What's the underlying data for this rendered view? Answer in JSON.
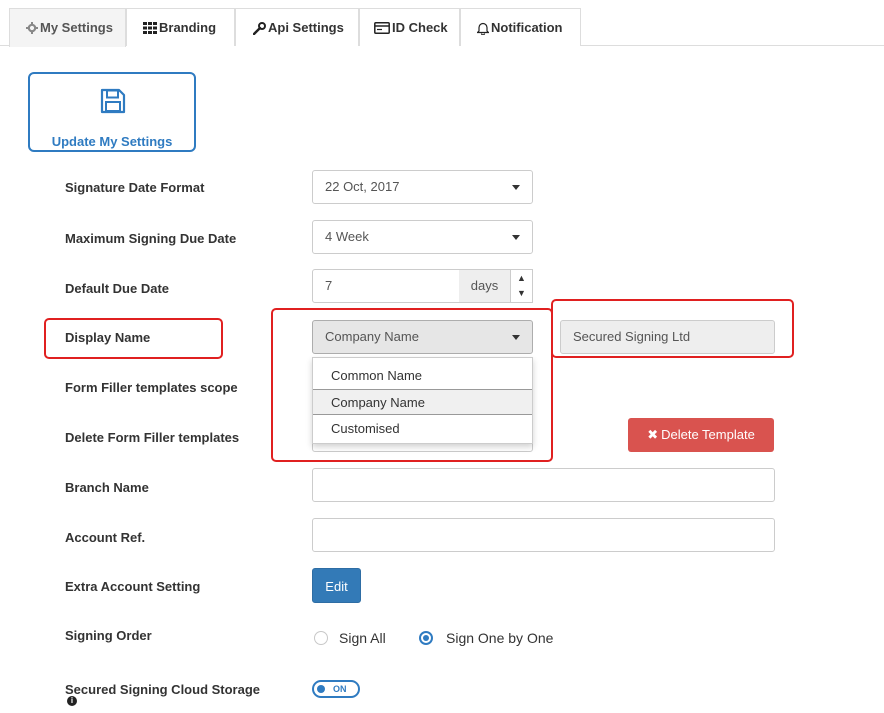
{
  "tabs": [
    {
      "label": "My Settings",
      "icon": "gear-icon",
      "active": true
    },
    {
      "label": "Branding",
      "icon": "grid-icon"
    },
    {
      "label": "Api Settings",
      "icon": "wrench-icon"
    },
    {
      "label": "ID Check",
      "icon": "id-card-icon"
    },
    {
      "label": "Notification",
      "icon": "bell-icon"
    }
  ],
  "update_button": {
    "label": "Update My Settings",
    "icon": "floppy-disk-icon"
  },
  "form": {
    "signature_date_format": {
      "label": "Signature Date Format",
      "value": "22 Oct, 2017"
    },
    "max_signing_due_date": {
      "label": "Maximum Signing Due Date",
      "value": "4 Week"
    },
    "default_due_date": {
      "label": "Default Due Date",
      "value": "7",
      "unit": "days"
    },
    "display_name": {
      "label": "Display Name",
      "value": "Company Name",
      "options": [
        "Common Name",
        "Company Name",
        "Customised"
      ],
      "preview": "Secured Signing Ltd"
    },
    "form_filler_scope": {
      "label": "Form Filler templates scope"
    },
    "delete_form_filler": {
      "label": "Delete Form Filler templates",
      "button": "Delete Template",
      "button_icon": "x-icon"
    },
    "branch_name": {
      "label": "Branch Name",
      "value": ""
    },
    "account_ref": {
      "label": "Account Ref.",
      "value": ""
    },
    "extra_account_setting": {
      "label": "Extra Account Setting",
      "button": "Edit"
    },
    "signing_order": {
      "label": "Signing Order",
      "options": [
        "Sign All",
        "Sign One by One"
      ],
      "selected": "Sign One by One"
    },
    "cloud_storage": {
      "label": "Secured Signing Cloud Storage",
      "toggle": "ON",
      "info_icon": "info-icon"
    }
  },
  "colors": {
    "accent": "#2f7bc1",
    "danger": "#d9534f",
    "primary": "#337ab7",
    "highlight": "#e02020"
  }
}
